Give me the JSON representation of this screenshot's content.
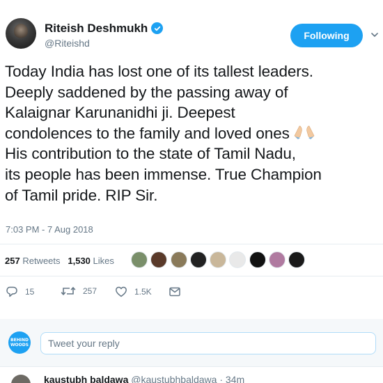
{
  "author": {
    "display_name": "Riteish Deshmukh",
    "handle": "@Riteishd",
    "verified": true
  },
  "follow_button": {
    "label": "Following"
  },
  "tweet": {
    "lines": [
      "Today India has lost one of its tallest leaders.",
      "Deeply saddened by the passing away of",
      "Kalaignar Karunanidhi ji. Deepest",
      "condolences to the family and loved ones",
      "His contribution to the state of Tamil Nadu,",
      "its people has been immense. True Champion",
      "of Tamil pride. RIP Sir."
    ],
    "emoji": "folded-hands",
    "timestamp": "7:03 PM - 7 Aug 2018"
  },
  "stats": {
    "retweets_count": "257",
    "retweets_label": "Retweets",
    "likes_count": "1,530",
    "likes_label": "Likes",
    "likers": [
      {
        "color": "#7a8f6a",
        "text": ""
      },
      {
        "color": "#5a3a2a",
        "text": ""
      },
      {
        "color": "#8a7a5a",
        "text": ""
      },
      {
        "color": "#222222",
        "text": ""
      },
      {
        "color": "#c9b79a",
        "text": ""
      },
      {
        "color": "#e9e9e9",
        "text": ""
      },
      {
        "color": "#111111",
        "text": ""
      },
      {
        "color": "#b07aa0",
        "text": ""
      },
      {
        "color": "#1a1a1a",
        "text": ""
      }
    ]
  },
  "actions": {
    "replies": "15",
    "retweets": "257",
    "likes": "1.5K"
  },
  "reply_box": {
    "logo_text": "BEHIND WOODS",
    "placeholder": "Tweet your reply"
  },
  "next_reply": {
    "name": "kaustubh baldawa",
    "handle": "@kaustubhbaldawa",
    "time": "· 34m"
  },
  "colors": {
    "brand_blue": "#1da1f2",
    "muted": "#657786",
    "text": "#14171a"
  }
}
